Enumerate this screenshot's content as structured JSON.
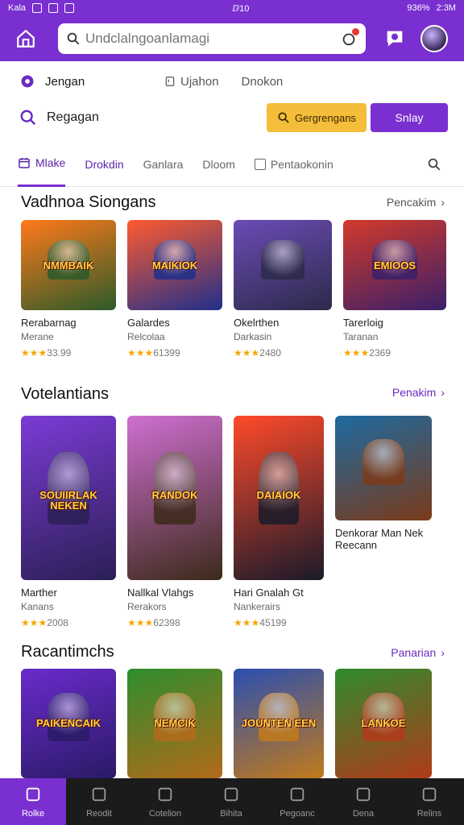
{
  "status_bar": {
    "left_text": "Kala",
    "right_text": "ⅅ10",
    "battery": "936%",
    "time": "2:3M"
  },
  "header": {
    "search_placeholder": "Undclalngoanlamagi"
  },
  "row1": {
    "label": "Jengan",
    "sub1": "Ujahon",
    "sub2": "Dnokon"
  },
  "row2": {
    "label": "Regagan",
    "yellow_button": "Gergrengans",
    "purple_button": "Snlay"
  },
  "tabs": [
    {
      "label": "Mlake"
    },
    {
      "label": "Drokdin"
    },
    {
      "label": "Ganlara"
    },
    {
      "label": "Dloom"
    },
    {
      "label": "Pentaokonin"
    }
  ],
  "section1": {
    "title": "Vadhnoa Siongans",
    "see_all": "Pencakim",
    "items": [
      {
        "name": "Rerabarnag",
        "dev": "Merane",
        "rating": "33.99",
        "art": "NMMBAIK",
        "colors": [
          "#ff7a1a",
          "#2c5a2a"
        ]
      },
      {
        "name": "Galardes",
        "dev": "Relcolaa",
        "rating": "61399",
        "art": "MAIKIOK",
        "colors": [
          "#ff5b2f",
          "#1f2f8a"
        ]
      },
      {
        "name": "Okelrthen",
        "dev": "Darkasin",
        "rating": "2480",
        "art": "",
        "colors": [
          "#6b4bb6",
          "#2d2a4a"
        ]
      },
      {
        "name": "Tarerloig",
        "dev": "Taranan",
        "rating": "2369",
        "art": "EMIOOS",
        "colors": [
          "#d23a2a",
          "#3a1f6a"
        ]
      }
    ]
  },
  "section2": {
    "title": "Votelantians",
    "see_all": "Penakim",
    "items": [
      {
        "name": "Marther",
        "dev": "Kanans",
        "rating": "2008",
        "art": "SOUIIRLAK NEKEN",
        "colors": [
          "#7b3bd6",
          "#2b1f55"
        ]
      },
      {
        "name": "Nallkal Vlahgs",
        "dev": "Rerakors",
        "rating": "62398",
        "art": "RANDOK",
        "colors": [
          "#cf6fd1",
          "#3c2a1a"
        ]
      },
      {
        "name": "Hari Gnalah Gt",
        "dev": "Nankerairs",
        "rating": "45199",
        "art": "DAIAIOK",
        "colors": [
          "#ff4a2a",
          "#1a1a2a"
        ]
      },
      {
        "name": "Denkorar Man Nek Reecann",
        "dev": "",
        "rating": "",
        "art": "",
        "colors": [
          "#1d6aa0",
          "#7b3a1a"
        ]
      }
    ]
  },
  "section3": {
    "title": "Racantimchs",
    "see_all": "Panarian",
    "items": [
      {
        "art": "PAIKENCAIK",
        "colors": [
          "#6a2bcc",
          "#2a1a66"
        ]
      },
      {
        "art": "NEMCIK",
        "colors": [
          "#2e8d2e",
          "#b36a1a"
        ]
      },
      {
        "art": "JOUNTEN EEN",
        "colors": [
          "#2a4fb0",
          "#c27a1a"
        ]
      },
      {
        "art": "LANKOE",
        "colors": [
          "#2f8b2f",
          "#b13a1a"
        ]
      }
    ]
  },
  "bottom_nav": [
    {
      "label": "Rolke"
    },
    {
      "label": "Reodit"
    },
    {
      "label": "Cotelion"
    },
    {
      "label": "Bihita"
    },
    {
      "label": "Pegoanc"
    },
    {
      "label": "Dena"
    },
    {
      "label": "Relins"
    }
  ],
  "accent_color": "#7a2fd0",
  "icons": [
    "home-icon",
    "search-icon",
    "notification-icon",
    "chat-icon",
    "gear-icon",
    "calendar-icon",
    "checkbox-icon",
    "star-icon"
  ]
}
